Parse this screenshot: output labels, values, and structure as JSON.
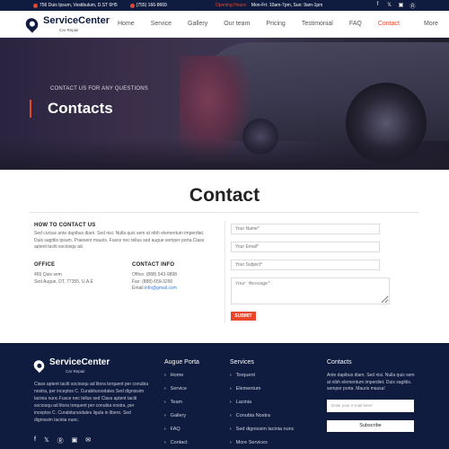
{
  "topbar": {
    "address": "756 Duis Ipsum, Vestibulum, D.ST 6H5",
    "phone": "(755) 166-8669",
    "hours_label": "Opening Hours:",
    "hours": "Mon-Fri: 10am-7pm, Sun: 9am-1pm",
    "socials": [
      "facebook-icon",
      "twitter-icon",
      "instagram-icon",
      "pinterest-icon"
    ]
  },
  "header": {
    "brand": "ServiceCenter",
    "tagline": "Car Repair",
    "nav": [
      "Home",
      "Service",
      "Gallery",
      "Our team",
      "Pricing",
      "Testimonial",
      "FAQ",
      "Contact",
      "More"
    ],
    "active": "Contact"
  },
  "hero": {
    "kicker": "CONTACT US FOR ANY QUESTIONS",
    "title": "Contacts"
  },
  "contact": {
    "heading": "Contact",
    "howto_title": "HOW TO CONTACT US",
    "howto_text": "Sed cursus ante dapibus diam. Sed nisi. Nulla quis sem at nibh elementum imperdiet. Duis sagittis ipsum. Praesent mauris. Fusce nec tellus sed augue semper porta.Class aptent taciti sociosqu ad.",
    "office_title": "OFFICE",
    "office_line1": "455 Quis sem",
    "office_line2": "Sed Augue, DT, 77355, U.A.E",
    "info_title": "CONTACT INFO",
    "info_office": "Office: (888) 543-9898",
    "info_fax": "Fax: (888) 659-3290",
    "info_email_label": "Email:",
    "info_email": "info@gmail.com",
    "form": {
      "name_placeholder": "Your Name*",
      "email_placeholder": "Your Email*",
      "subject_placeholder": "Your Subject*",
      "message_placeholder": "Your Message*",
      "submit_label": "SUBMIT"
    }
  },
  "footer": {
    "brand": "ServiceCenter",
    "tagline": "Car Repair",
    "description": "Class aptent taciti sociosqu ad litora torquent per conubia nostra, per inceptos C. Curabitursodales Sed dignissim lacinia nunc.Fusce nec tellus sed Class aptent taciti sociosqu ad litora torquent per conubia nostra, per inceptos C. Curabitursodales ligula in libero. Sed dignissim lacinia nunc.",
    "socials": [
      "facebook-icon",
      "twitter-icon",
      "pinterest-icon",
      "instagram-icon",
      "email-icon"
    ],
    "col1_title": "Augue Porta",
    "col1_items": [
      "Home",
      "Service",
      "Team",
      "Gallery",
      "FAQ",
      "Contact"
    ],
    "col2_title": "Services",
    "col2_items": [
      "Torquent",
      "Elementum",
      "Lacinia",
      "Conubia Nostra",
      "Sed dignissim lacinia nunc",
      "More Services"
    ],
    "col3_title": "Contacts",
    "col3_text": "Ante dapibus diam. Sed nisi. Nulla quis sem at nibh elementum imperdiet. Duis sagittis. semper porta. Mauris massa!",
    "email_placeholder": "Enter your e-mail here*",
    "subscribe_label": "Subscribe"
  },
  "colors": {
    "navy": "#0f1c3f",
    "accent": "#e8472c"
  }
}
